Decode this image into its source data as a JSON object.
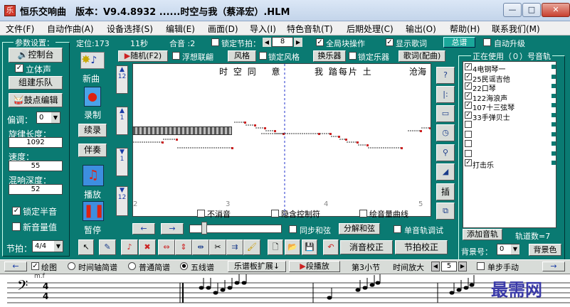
{
  "window": {
    "title": "恒乐交响曲　版本：V9.4.8932 ......时空与我（蔡泽宏）.HLM",
    "icon_text": "乐",
    "min": "—",
    "max": "□",
    "close": "✕"
  },
  "menu": [
    "文件(F)",
    "自动作曲(A)",
    "设备选择(S)",
    "编辑(E)",
    "画面(D)",
    "导入(I)",
    "特色音轨(T)",
    "后期处理(C)",
    "输出(O)",
    "帮助(H)",
    "联系我们(M)"
  ],
  "left": {
    "group_title": "参数设置：",
    "control_btn": "控制台",
    "stereo": "立体声",
    "stereo_checked": "✓",
    "band_btn": "组建乐队",
    "drum_btn": "鼓点编辑",
    "transpose_label": "偏调：",
    "transpose_value": "0",
    "melody_len_label": "旋律长度：",
    "melody_len_value": "1092",
    "speed_label": "速度：",
    "speed_value": "55",
    "reverb_label": "混响深度：",
    "reverb_value": "52",
    "lock_half": "锁定半音",
    "lock_half_checked": "✓",
    "new_vol": "新音量值",
    "beat_label": "节拍：",
    "beat_value": "4/4"
  },
  "tools": {
    "new": "新曲",
    "record": "录制",
    "continue": "续录",
    "accompany": "伴奏",
    "play": "播放",
    "pause": "暂停"
  },
  "toolbar": {
    "position": "定位:173",
    "seconds": "11秒",
    "harmony": "合音 :2",
    "lock_beat": "锁定节拍：",
    "beat_num": "8",
    "global": "全局块操作",
    "show_lyrics": "显示歌词",
    "total": "总谱",
    "auto_upgrade": "自动升级",
    "random": "随机(F2)",
    "float": "浮想联翩",
    "style": "风格",
    "lock_style": "锁定风格",
    "change_inst": "换乐器",
    "lock_inst": "锁定乐器",
    "lyrics_btn": "歌词(配曲)"
  },
  "score": {
    "lyrics": [
      "时",
      "空",
      "同",
      "意",
      "我",
      "踏",
      "每",
      "片",
      "土",
      "沧",
      "海"
    ],
    "bar_nums": [
      "2",
      "3",
      "4",
      "5"
    ],
    "no_sustain": "不消音",
    "hidden_ctrl": "隐含控制符",
    "vol_curve": "绘音量曲线",
    "sync_chord": "同步和弦",
    "split_chord": "分解和弦",
    "single_debug": "单音轨调试",
    "vert_nums": [
      "12",
      "1",
      "1",
      "12"
    ]
  },
  "bottom_btns": {
    "vol_correct": "消音校正",
    "beat_correct": "节拍校正"
  },
  "right": {
    "header": "正在使用（０）号音轨",
    "tracks": [
      {
        "name": "4电钢琴一",
        "checked": "✓"
      },
      {
        "name": "25民谣吉他",
        "checked": "✓"
      },
      {
        "name": "22口琴",
        "checked": "✓"
      },
      {
        "name": "122海浪声",
        "checked": "✓"
      },
      {
        "name": "107十三弦琴",
        "checked": "✓"
      },
      {
        "name": "33手弹贝士",
        "checked": "✓"
      },
      {
        "name": "",
        "checked": ""
      },
      {
        "name": "",
        "checked": ""
      },
      {
        "name": "",
        "checked": ""
      },
      {
        "name": "",
        "checked": ""
      },
      {
        "name": "打击乐",
        "checked": "✓"
      }
    ],
    "add_track": "添加音轨",
    "track_count": "轨道数=7",
    "bg_label": "背景号：",
    "bg_value": "0",
    "bg_color": "背景色"
  },
  "view_bar": {
    "draw": "绘图",
    "time_axis": "时间轴简谱",
    "normal": "普通简谱",
    "staff": "五线谱",
    "expand": "乐谱板扩展↓",
    "segment_play": "段播放",
    "section": "第3小节",
    "zoom_label": "时间放大",
    "zoom_value": "5",
    "single_manual": "单步手动"
  },
  "staff": {
    "clef": "𝄢",
    "time_top": "4",
    "time_bottom": "4",
    "dyn": "m.f",
    "watermark": "最需网"
  },
  "colors": {
    "teal": "#0a7a72",
    "accent": "#1aa79a"
  }
}
